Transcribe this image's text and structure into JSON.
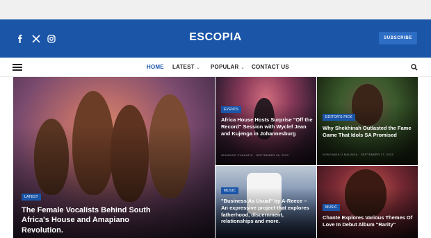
{
  "header": {
    "logo": "ESCOPIA",
    "subscribe_label": "SUBSCRIBE",
    "social": [
      {
        "icon": "facebook-icon",
        "glyph": "f"
      },
      {
        "icon": "x-twitter-icon",
        "glyph": "X"
      },
      {
        "icon": "instagram-icon",
        "glyph": "◎"
      }
    ]
  },
  "nav": {
    "items": [
      {
        "label": "HOME",
        "active": true
      },
      {
        "label": "LATEST",
        "dropdown": true
      },
      {
        "label": "POPULAR",
        "dropdown": true
      },
      {
        "label": "CONTACT US"
      }
    ]
  },
  "articles": {
    "featured": {
      "badge": "LATEST",
      "title": "The Female Vocalists Behind South Africa's House and Amapiano Revolution."
    },
    "a2": {
      "badge": "EVENTS",
      "title": "Africa House Hosts Surprise \"Off the Record\" Session with Wyclef Jean and Kujenga in Johannesburg",
      "meta": "ATANDISO PHAKATHI · SEPTEMBER 26, 2023"
    },
    "a3": {
      "badge": "EDITOR'S PICK",
      "title": "Why Shekhinah Outlasted the Fame Game That Idols SA Promised",
      "meta": "NONGAWULO MALINGA · SEPTEMBER 17, 2023"
    },
    "a4": {
      "badge": "MUSIC",
      "title": "\"Business As Usual\" by A-Reece – An expressive project that explores fatherhood, discernment, relationships and more."
    },
    "a5": {
      "badge": "MUSIC",
      "title": "Chante Explores Various Themes Of Love In Debut Album \"Rarity\""
    }
  },
  "colors": {
    "brand_blue": "#1a55a8",
    "top_strip": "#f0f0f0",
    "subscribe_bg": "#2d6dc4"
  }
}
